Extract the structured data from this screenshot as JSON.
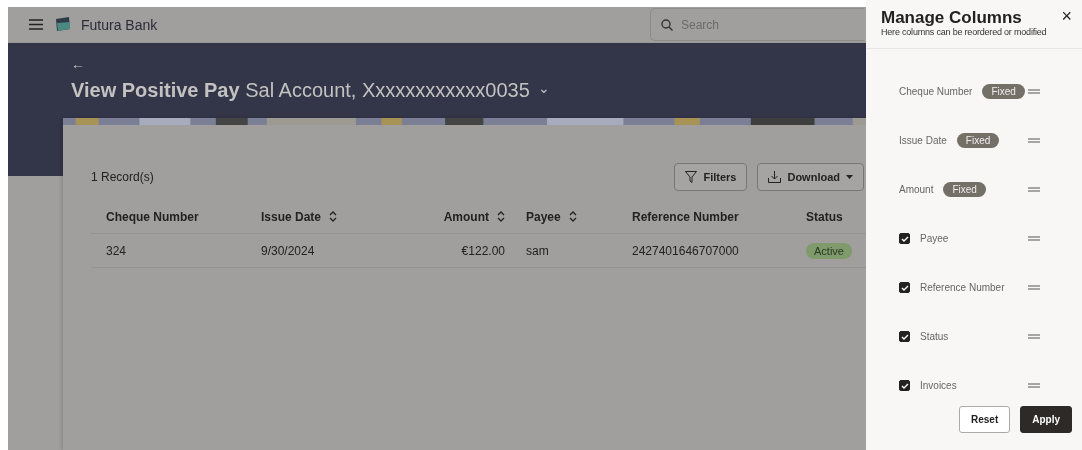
{
  "header": {
    "brand": "Futura Bank",
    "search": {
      "placeholder": "Search"
    }
  },
  "page": {
    "back": "←",
    "title": "View Positive Pay",
    "account": "Sal Account, Xxxxxxxxxxxx0035",
    "caret": "⌄"
  },
  "records": "1 Record(s)",
  "toolbar": {
    "filters": "Filters",
    "download": "Download"
  },
  "table": {
    "columns": [
      {
        "label": "Cheque Number",
        "sortable": false
      },
      {
        "label": "Issue Date",
        "sortable": true
      },
      {
        "label": "Amount",
        "sortable": true
      },
      {
        "label": "Payee",
        "sortable": true
      },
      {
        "label": "Reference Number",
        "sortable": false
      },
      {
        "label": "Status",
        "sortable": false
      }
    ],
    "rows": [
      {
        "cells": [
          "324",
          "9/30/2024",
          "€122.00",
          "sam",
          "2427401646707000"
        ],
        "status": "Active"
      }
    ]
  },
  "panel": {
    "title": "Manage Columns",
    "subtitle": "Here columns can be reordered or modified",
    "close": "×",
    "items": [
      {
        "kind": "fixed",
        "label": "Cheque Number",
        "badge": "Fixed"
      },
      {
        "kind": "fixed",
        "label": "Issue Date",
        "badge": "Fixed"
      },
      {
        "kind": "fixed",
        "label": "Amount",
        "badge": "Fixed"
      },
      {
        "kind": "checkbox",
        "label": "Payee",
        "checked": true
      },
      {
        "kind": "checkbox",
        "label": "Reference Number",
        "checked": true
      },
      {
        "kind": "checkbox",
        "label": "Status",
        "checked": true
      },
      {
        "kind": "checkbox",
        "label": "Invoices",
        "checked": true
      }
    ],
    "buttons": [
      {
        "label": "Reset",
        "primary": false
      },
      {
        "label": "Apply",
        "primary": true
      }
    ]
  }
}
